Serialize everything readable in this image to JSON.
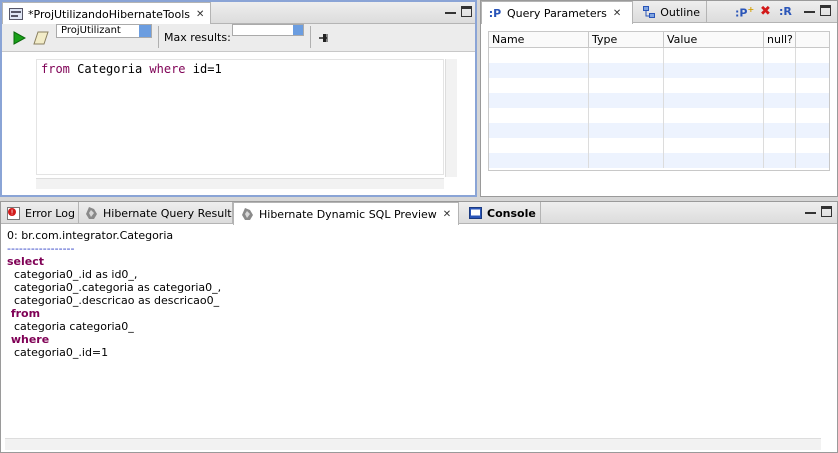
{
  "editor": {
    "tab_title": "*ProjUtilizandoHibernateTools",
    "config_label": "ProjUtilizant",
    "max_results_label": "Max results:",
    "query_keyword_from": "from",
    "query_entity": "Categoria",
    "query_keyword_where": "where",
    "query_condition": "id=1"
  },
  "params": {
    "tab_query_parameters": "Query Parameters",
    "tab_outline": "Outline",
    "columns": [
      "Name",
      "Type",
      "Value",
      "null?"
    ]
  },
  "bottom": {
    "tab_error_log": "Error Log",
    "tab_hql_result": "Hibernate Query Result",
    "tab_sql_preview": "Hibernate Dynamic SQL Preview",
    "tab_console": "Console",
    "sql_header": "0: br.com.integrator.Categoria",
    "sql_divider": "-----------------",
    "sql_select": "select",
    "sql_col1": "  categoria0_.id as id0_,",
    "sql_col2": "  categoria0_.categoria as categoria0_,",
    "sql_col3": "  categoria0_.descricao as descricao0_",
    "sql_from": " from",
    "sql_table": "  categoria categoria0_",
    "sql_where": " where",
    "sql_condition": "  categoria0_.id=1"
  },
  "icons": {
    "run": "run-icon",
    "clear": "eraser-icon",
    "pin": "pin-icon",
    "params": "query-params-icon",
    "outline": "outline-icon",
    "error": "error-log-icon",
    "hibernate": "hibernate-icon",
    "console": "console-icon"
  },
  "colors": {
    "keyword": "#7f0055",
    "active_border": "#8aa4d6",
    "alt_row": "#edf3fe"
  }
}
